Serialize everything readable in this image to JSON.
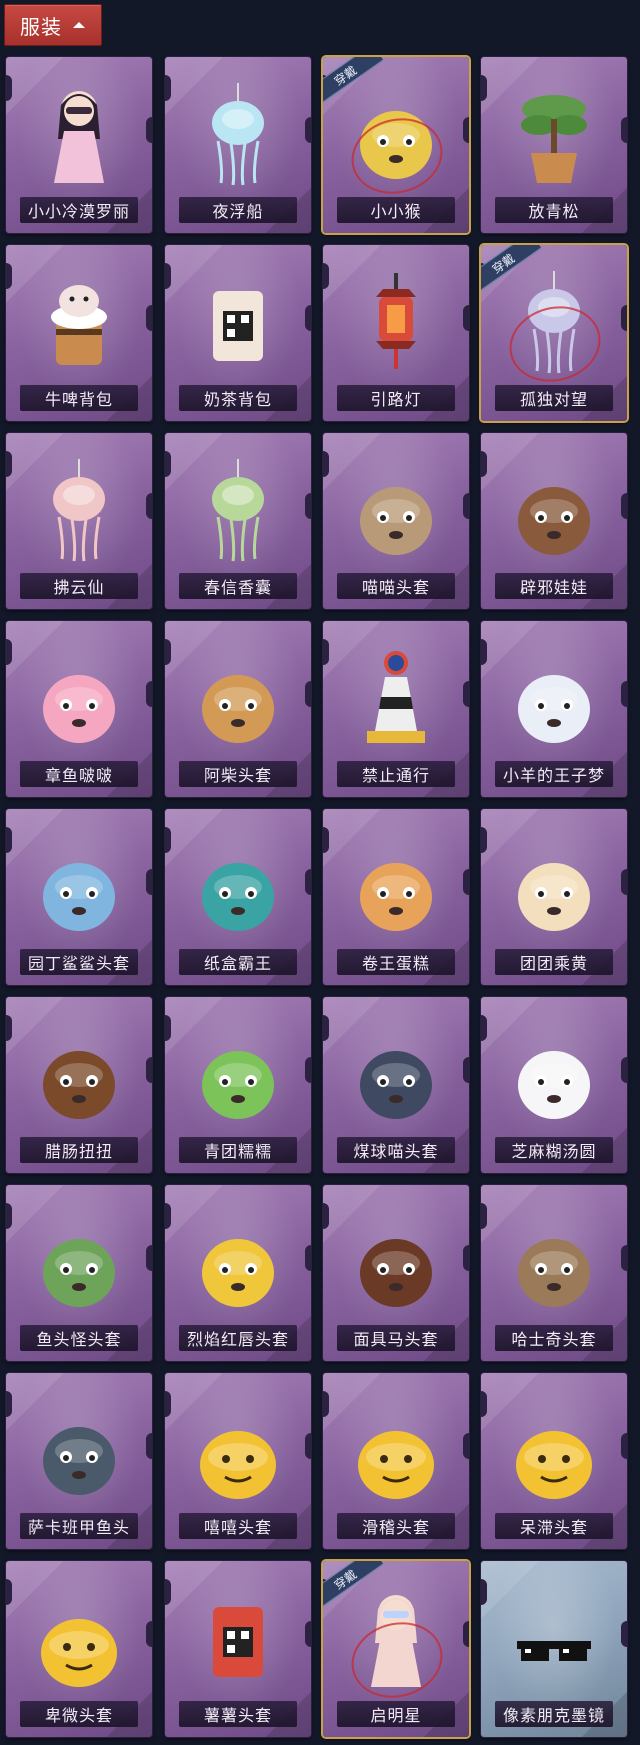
{
  "header": {
    "title": "服装",
    "chevron_icon": "chevron-up-icon"
  },
  "worn_label": "穿戴",
  "items": [
    {
      "name": "小小冷漠罗丽",
      "icon": "doll-icon",
      "worn": false,
      "blue": false,
      "color": "#f1c2d9"
    },
    {
      "name": "夜浮船",
      "icon": "jellyfish-icon",
      "worn": false,
      "blue": false,
      "color": "#b9e6f2"
    },
    {
      "name": "小小猴",
      "icon": "monkey-icon",
      "worn": true,
      "blue": false,
      "color": "#e9c74a"
    },
    {
      "name": "放青松",
      "icon": "bonsai-pine-icon",
      "worn": false,
      "blue": false,
      "color": "#5f9a4a"
    },
    {
      "name": "牛啤背包",
      "icon": "cow-beer-icon",
      "worn": false,
      "blue": false,
      "color": "#c98b4e"
    },
    {
      "name": "奶茶背包",
      "icon": "milktea-icon",
      "worn": false,
      "blue": false,
      "color": "#f2e6da"
    },
    {
      "name": "引路灯",
      "icon": "lantern-icon",
      "worn": false,
      "blue": false,
      "color": "#d84a3a"
    },
    {
      "name": "孤独对望",
      "icon": "charm-figure-icon",
      "worn": true,
      "blue": false,
      "color": "#c9c8e8"
    },
    {
      "name": "拂云仙",
      "icon": "fairy-charm-icon",
      "worn": false,
      "blue": false,
      "color": "#f0c6c6"
    },
    {
      "name": "春信香囊",
      "icon": "sachet-icon",
      "worn": false,
      "blue": false,
      "color": "#b8d89a"
    },
    {
      "name": "喵喵头套",
      "icon": "cat-head-icon",
      "worn": false,
      "blue": false,
      "color": "#b99a78"
    },
    {
      "name": "辟邪娃娃",
      "icon": "doll-head-icon",
      "worn": false,
      "blue": false,
      "color": "#8a5a3c"
    },
    {
      "name": "章鱼啵啵",
      "icon": "octopus-icon",
      "worn": false,
      "blue": false,
      "color": "#f5a7c2"
    },
    {
      "name": "阿柴头套",
      "icon": "shiba-head-icon",
      "worn": false,
      "blue": false,
      "color": "#d39a55"
    },
    {
      "name": "禁止通行",
      "icon": "traffic-cone-icon",
      "worn": false,
      "blue": false,
      "color": "#e6b93a"
    },
    {
      "name": "小羊的王子梦",
      "icon": "sheep-crown-icon",
      "worn": false,
      "blue": false,
      "color": "#e9eef7"
    },
    {
      "name": "园丁鲨鲨头套",
      "icon": "shark-head-icon",
      "worn": false,
      "blue": false,
      "color": "#7fb5de"
    },
    {
      "name": "纸盒霸王",
      "icon": "box-dino-icon",
      "worn": false,
      "blue": false,
      "color": "#3aa3a3"
    },
    {
      "name": "卷王蛋糕",
      "icon": "roll-cake-icon",
      "worn": false,
      "blue": false,
      "color": "#e8a35a"
    },
    {
      "name": "团团乘黄",
      "icon": "cream-creature-icon",
      "worn": false,
      "blue": false,
      "color": "#f3dfbe"
    },
    {
      "name": "腊肠扭扭",
      "icon": "dachshund-icon",
      "worn": false,
      "blue": false,
      "color": "#7a4a2a"
    },
    {
      "name": "青团糯糯",
      "icon": "green-dumpling-icon",
      "worn": false,
      "blue": false,
      "color": "#7cc35a"
    },
    {
      "name": "煤球喵头套",
      "icon": "gray-cat-icon",
      "worn": false,
      "blue": false,
      "color": "#3f4a62"
    },
    {
      "name": "芝麻糊汤圆",
      "icon": "tangyuan-icon",
      "worn": false,
      "blue": false,
      "color": "#f6f6f8"
    },
    {
      "name": "鱼头怪头套",
      "icon": "fish-head-icon",
      "worn": false,
      "blue": false,
      "color": "#6ea35a"
    },
    {
      "name": "烈焰红唇头套",
      "icon": "pikachu-head-icon",
      "worn": false,
      "blue": false,
      "color": "#f0c63a"
    },
    {
      "name": "面具马头套",
      "icon": "horse-mask-icon",
      "worn": false,
      "blue": false,
      "color": "#6b3a26"
    },
    {
      "name": "哈士奇头套",
      "icon": "husky-head-icon",
      "worn": false,
      "blue": false,
      "color": "#9a7a58"
    },
    {
      "name": "萨卡班甲鱼头",
      "icon": "sacabambaspis-icon",
      "worn": false,
      "blue": false,
      "color": "#4a5a6a"
    },
    {
      "name": "嘻嘻头套",
      "icon": "grin-emoji-icon",
      "worn": false,
      "blue": false,
      "color": "#f3c233"
    },
    {
      "name": "滑稽头套",
      "icon": "smirk-emoji-icon",
      "worn": false,
      "blue": false,
      "color": "#f3c233"
    },
    {
      "name": "呆滞头套",
      "icon": "stare-emoji-icon",
      "worn": false,
      "blue": false,
      "color": "#f3c233"
    },
    {
      "name": "卑微头套",
      "icon": "timid-emoji-icon",
      "worn": false,
      "blue": false,
      "color": "#f3c233"
    },
    {
      "name": "薯薯头套",
      "icon": "sticker-box-icon",
      "worn": false,
      "blue": false,
      "color": "#d94a3a"
    },
    {
      "name": "启明星",
      "icon": "mannequin-glasses-icon",
      "worn": true,
      "blue": false,
      "color": "#f3d6cf"
    },
    {
      "name": "像素朋克墨镜",
      "icon": "pixel-sunglasses-icon",
      "worn": false,
      "blue": true,
      "color": "#111111"
    }
  ]
}
